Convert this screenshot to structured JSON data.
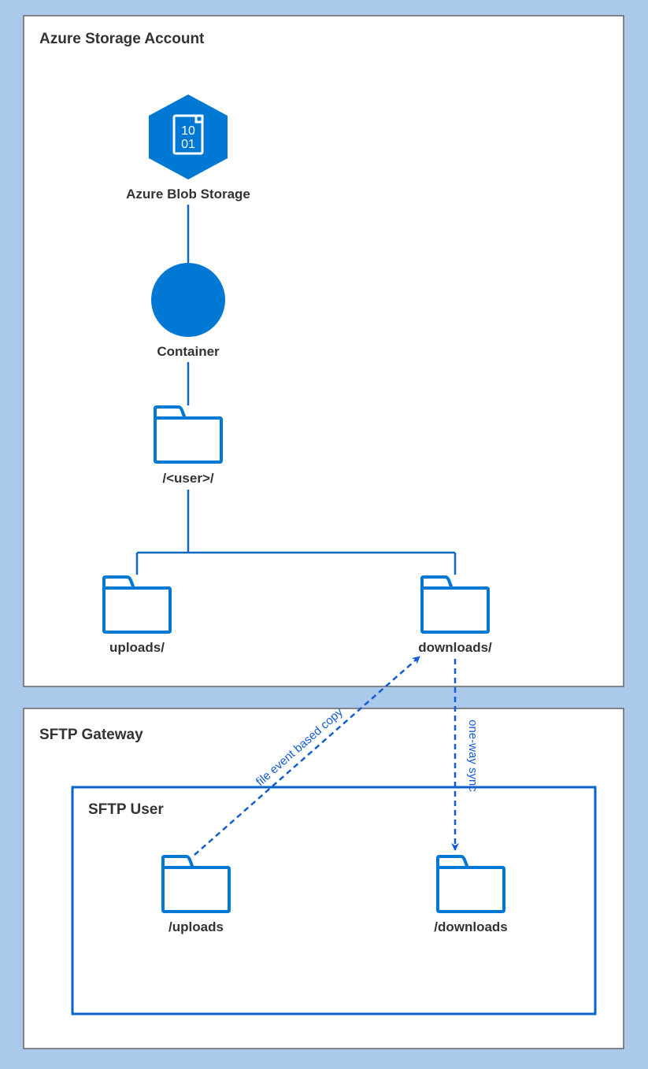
{
  "diagram": {
    "storage_box_title": "Azure Storage Account",
    "blob_label": "Azure Blob Storage",
    "container_label": "Container",
    "user_folder_label": "/<user>/",
    "uploads_folder_label": "uploads/",
    "downloads_folder_label": "downloads/",
    "gateway_box_title": "SFTP Gateway",
    "sftp_user_box_title": "SFTP User",
    "sftp_uploads_label": "/uploads",
    "sftp_downloads_label": "/downloads",
    "edge_copy_label": "file event based copy",
    "edge_sync_label": "one-way sync"
  },
  "colors": {
    "background": "#AAC9EB",
    "panel_fill": "#FFFFFF",
    "panel_stroke": "#666666",
    "azure_blue": "#0078D4",
    "line_blue": "#1168BD",
    "dashed_blue": "#155BD4"
  }
}
